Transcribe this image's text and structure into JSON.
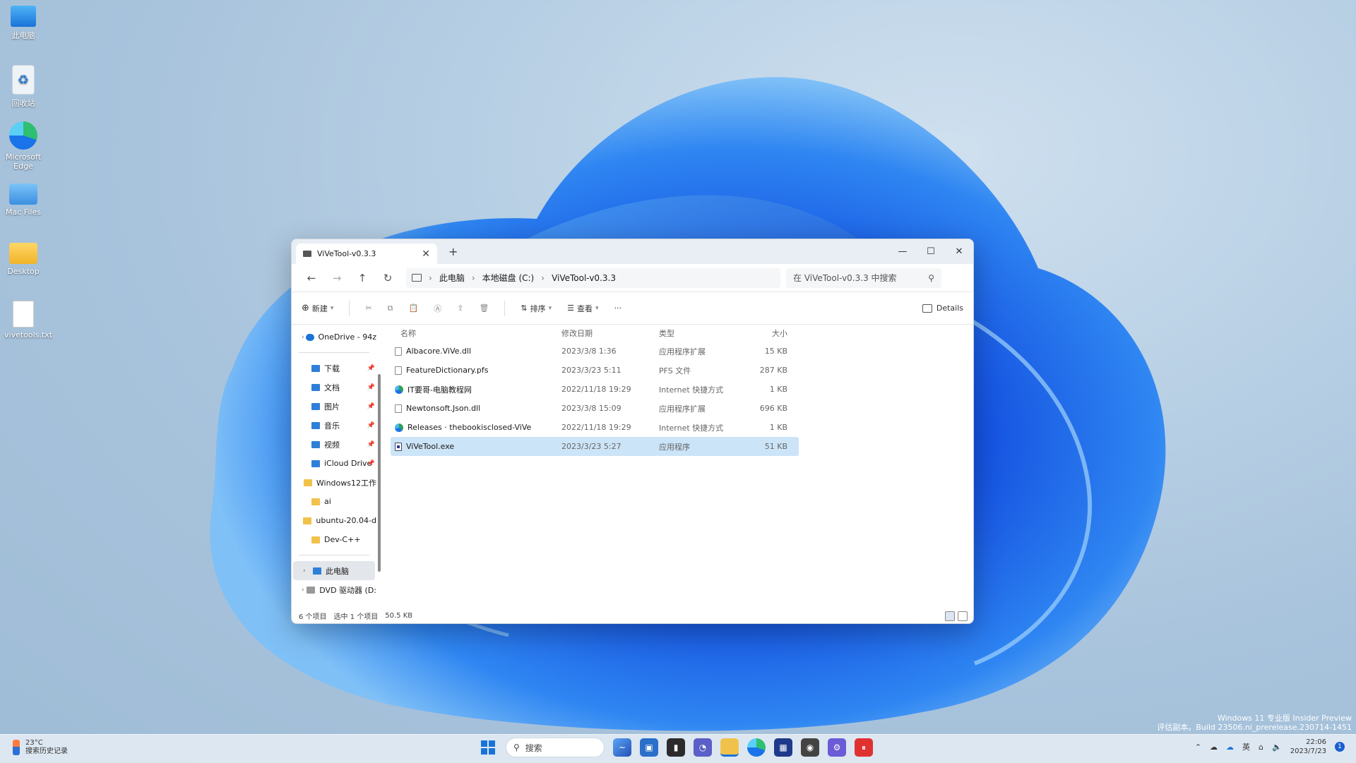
{
  "desktop": {
    "icons": [
      {
        "label": "此电脑"
      },
      {
        "label": "回收站"
      },
      {
        "label": "Microsoft Edge"
      },
      {
        "label": "Mac Files"
      },
      {
        "label": "Desktop"
      },
      {
        "label": "vivetools.txt"
      }
    ],
    "watermark_line1": "Windows 11 专业版 Insider Preview",
    "watermark_line2": "评估副本。Build 23506.ni_prerelease.230714-1451"
  },
  "window": {
    "tab_title": "ViVeTool-v0.3.3",
    "breadcrumb": [
      "此电脑",
      "本地磁盘 (C:)",
      "ViVeTool-v0.3.3"
    ],
    "search_placeholder": "在 ViVeTool-v0.3.3 中搜索",
    "toolbar": {
      "new_label": "新建",
      "sort_label": "排序",
      "view_label": "查看",
      "more_label": "···",
      "details_label": "Details"
    },
    "nav": {
      "onedrive": "OneDrive - 94z",
      "items": [
        {
          "label": "下载",
          "icon": "download-folder",
          "color": "#2f7fd8"
        },
        {
          "label": "文档",
          "icon": "documents-folder",
          "color": "#2f7fd8"
        },
        {
          "label": "图片",
          "icon": "pictures-folder",
          "color": "#2f7fd8"
        },
        {
          "label": "音乐",
          "icon": "music-folder",
          "color": "#2f7fd8"
        },
        {
          "label": "视频",
          "icon": "videos-folder",
          "color": "#2f7fd8"
        },
        {
          "label": "iCloud Drive",
          "icon": "icloud-folder",
          "color": "#2f7fd8"
        },
        {
          "label": "Windows12工作",
          "icon": "folder",
          "color": "#f1c24b"
        },
        {
          "label": "ai",
          "icon": "folder",
          "color": "#f1c24b"
        },
        {
          "label": "ubuntu-20.04-d",
          "icon": "folder",
          "color": "#f1c24b"
        },
        {
          "label": "Dev-C++",
          "icon": "folder",
          "color": "#f1c24b"
        }
      ],
      "this_pc": "此电脑",
      "dvd": "DVD 驱动器 (D:"
    },
    "columns": {
      "name": "名称",
      "date": "修改日期",
      "type": "类型",
      "size": "大小"
    },
    "files": [
      {
        "name": "Albacore.ViVe.dll",
        "date": "2023/3/8 1:36",
        "type": "应用程序扩展",
        "size": "15 KB",
        "icon": "file",
        "selected": false
      },
      {
        "name": "FeatureDictionary.pfs",
        "date": "2023/3/23 5:11",
        "type": "PFS 文件",
        "size": "287 KB",
        "icon": "file",
        "selected": false
      },
      {
        "name": "IT要哥-电脑教程网",
        "date": "2022/11/18 19:29",
        "type": "Internet 快捷方式",
        "size": "1 KB",
        "icon": "web",
        "selected": false
      },
      {
        "name": "Newtonsoft.Json.dll",
        "date": "2023/3/8 15:09",
        "type": "应用程序扩展",
        "size": "696 KB",
        "icon": "file",
        "selected": false
      },
      {
        "name": "Releases · thebookisclosed-ViVe",
        "date": "2022/11/18 19:29",
        "type": "Internet 快捷方式",
        "size": "1 KB",
        "icon": "web",
        "selected": false
      },
      {
        "name": "ViVeTool.exe",
        "date": "2023/3/23 5:27",
        "type": "应用程序",
        "size": "51 KB",
        "icon": "exe",
        "selected": true
      }
    ],
    "status": {
      "count": "6 个项目",
      "selected": "选中 1 个项目",
      "size": "50.5 KB"
    }
  },
  "taskbar": {
    "weather_temp": "23°C",
    "weather_text": "搜索历史记录",
    "search_label": "搜索",
    "tray_lang": "英",
    "clock_time": "22:06",
    "clock_date": "2023/7/23",
    "notification_count": "1"
  }
}
